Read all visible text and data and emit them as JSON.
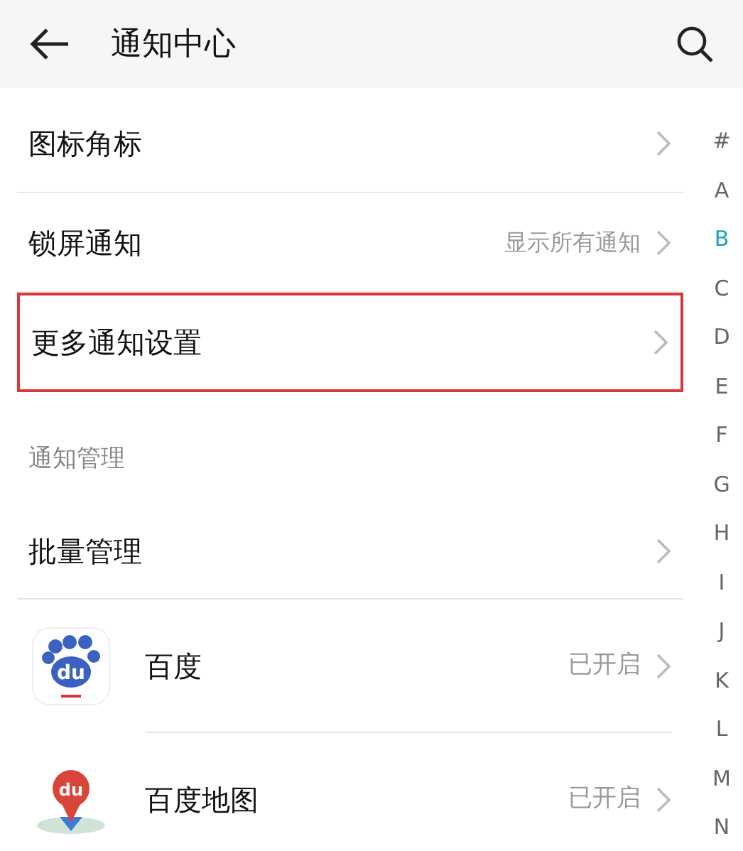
{
  "header": {
    "title": "通知中心"
  },
  "settings": [
    {
      "label": "图标角标",
      "highlighted": false
    },
    {
      "label": "锁屏通知",
      "value": "显示所有通知",
      "highlighted": false
    },
    {
      "label": "更多通知设置",
      "highlighted": true
    }
  ],
  "section": {
    "title": "通知管理"
  },
  "manage": [
    {
      "kind": "row",
      "label": "批量管理"
    },
    {
      "kind": "paw-app",
      "logo_text": "du",
      "label": "百度",
      "value": "已开启"
    },
    {
      "kind": "pin-app",
      "logo_text": "du",
      "label": "百度地图",
      "value": "已开启"
    }
  ],
  "index": [
    {
      "letter": "#",
      "selected": false
    },
    {
      "letter": "A",
      "selected": false
    },
    {
      "letter": "B",
      "selected": true
    },
    {
      "letter": "C",
      "selected": false
    },
    {
      "letter": "D",
      "selected": false
    },
    {
      "letter": "E",
      "selected": false
    },
    {
      "letter": "F",
      "selected": false
    },
    {
      "letter": "G",
      "selected": false
    },
    {
      "letter": "H",
      "selected": false
    },
    {
      "letter": "I",
      "selected": false
    },
    {
      "letter": "J",
      "selected": false
    },
    {
      "letter": "K",
      "selected": false
    },
    {
      "letter": "L",
      "selected": false
    },
    {
      "letter": "M",
      "selected": false
    },
    {
      "letter": "N",
      "selected": false
    }
  ]
}
